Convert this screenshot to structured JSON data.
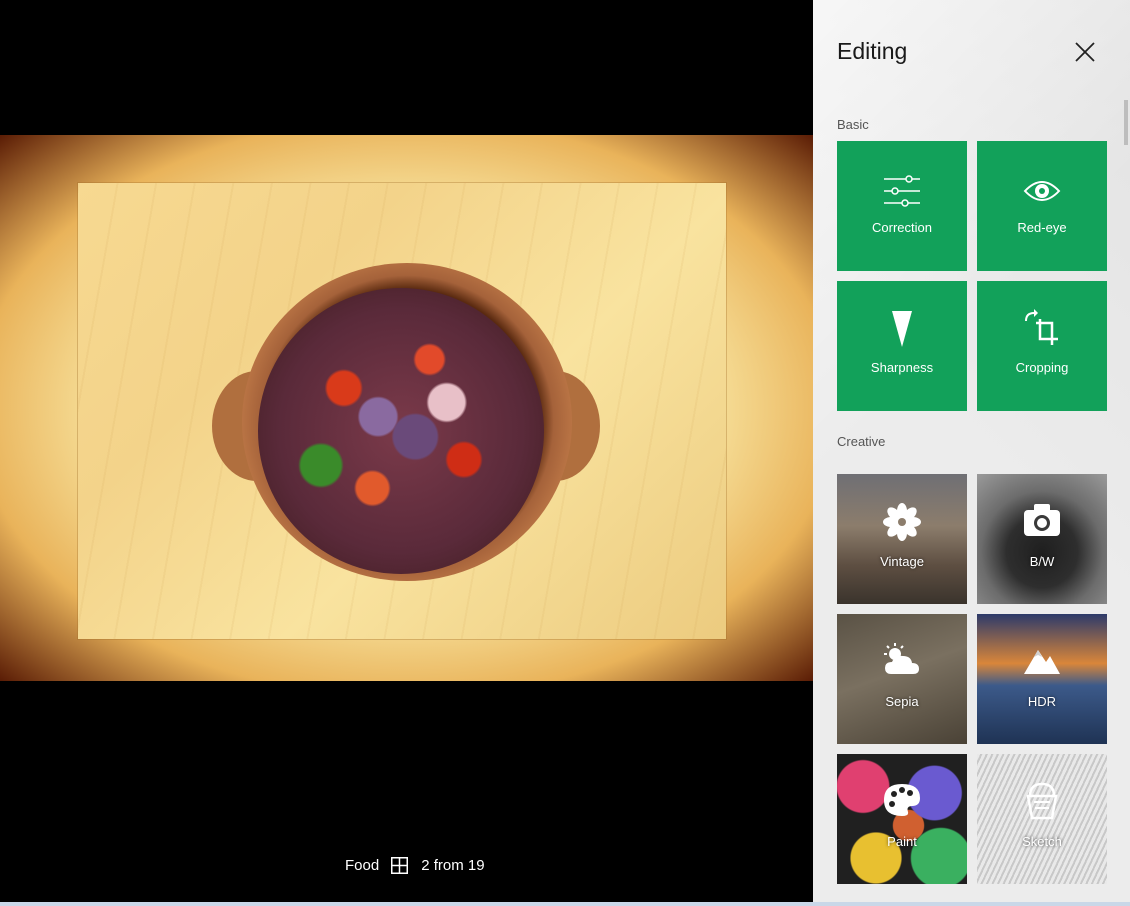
{
  "viewer": {
    "album": "Food",
    "counter": "2 from 19"
  },
  "panel": {
    "title": "Editing",
    "sections": {
      "basic": {
        "label": "Basic",
        "tools": [
          {
            "label": "Correction",
            "icon": "sliders-icon"
          },
          {
            "label": "Red-eye",
            "icon": "eye-icon"
          },
          {
            "label": "Sharpness",
            "icon": "sharpness-icon"
          },
          {
            "label": "Cropping",
            "icon": "crop-icon"
          }
        ]
      },
      "creative": {
        "label": "Creative",
        "tools": [
          {
            "label": "Vintage",
            "icon": "flower-icon"
          },
          {
            "label": "B/W",
            "icon": "camera-icon"
          },
          {
            "label": "Sepia",
            "icon": "cloud-sun-icon"
          },
          {
            "label": "HDR",
            "icon": "mountain-icon"
          },
          {
            "label": "Paint",
            "icon": "palette-icon"
          },
          {
            "label": "Sketch",
            "icon": "bucket-icon"
          }
        ]
      }
    }
  },
  "colors": {
    "accent": "#12a15a",
    "panel_bg": "#ececec",
    "viewer_bg": "#000000"
  }
}
